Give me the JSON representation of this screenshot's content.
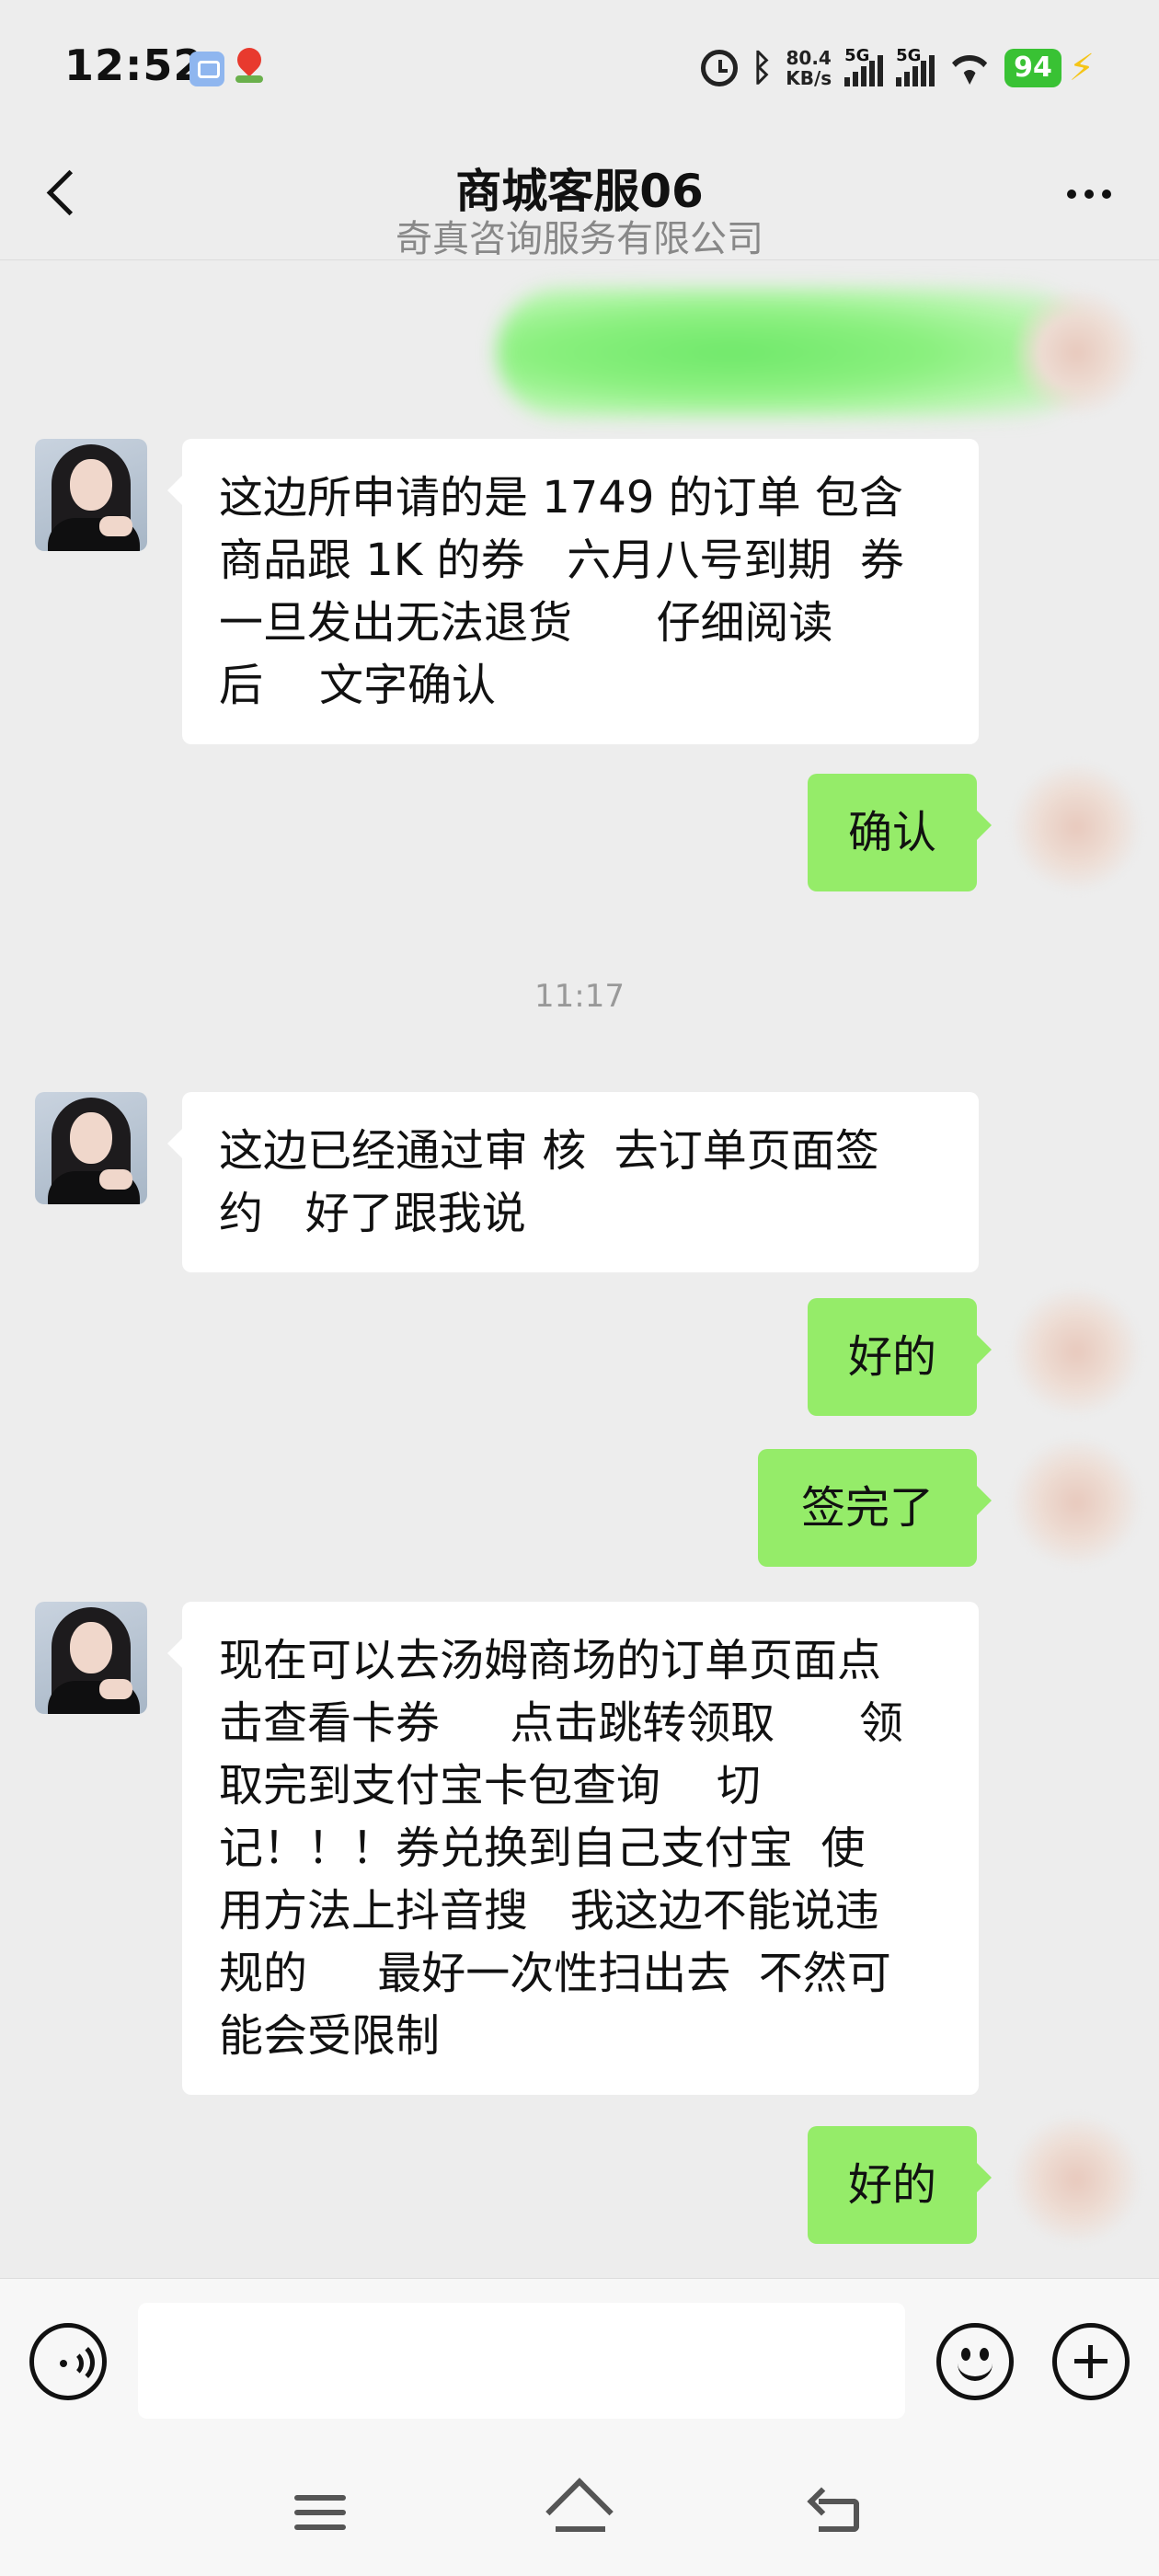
{
  "status_bar": {
    "time": "12:52",
    "net_speed_value": "80.4",
    "net_speed_unit": "KB/s",
    "sim1_label": "5G",
    "sim2_label": "5G",
    "battery": "94",
    "icons": [
      "app-notification-icon",
      "map-notification-icon",
      "alarm-icon",
      "bluetooth-icon",
      "signal-icon",
      "wifi-icon",
      "battery-icon",
      "charging-icon"
    ]
  },
  "header": {
    "title": "商城客服06",
    "subtitle": "奇真咨询服务有限公司"
  },
  "messages": [
    {
      "side": "left",
      "lines": [
        "这边所申请的是 1749 的订单 包含",
        "商品跟 1K 的券   六月八号到期  券",
        "一旦发出无法退货      仔细阅读",
        "后    文字确认"
      ]
    },
    {
      "side": "right",
      "text": "确认"
    },
    {
      "side": "left",
      "lines": [
        "这边已经通过审 核  去订单页面签",
        "约   好了跟我说"
      ]
    },
    {
      "side": "right",
      "text": "好的"
    },
    {
      "side": "right",
      "text": "签完了"
    },
    {
      "side": "left",
      "lines": [
        "现在可以去汤姆商场的订单页面点",
        "击查看卡券     点击跳转领取      领",
        "取完到支付宝卡包查询    切",
        "记！！！券兑换到自己支付宝  使",
        "用方法上抖音搜   我这边不能说违",
        "规的     最好一次性扫出去  不然可",
        "能会受限制"
      ]
    },
    {
      "side": "right",
      "text": "好的"
    }
  ],
  "timestamp": "11:17",
  "input_bar": {
    "placeholder": "",
    "icons": [
      "voice-icon",
      "emoji-icon",
      "plus-icon"
    ]
  },
  "nav_bar": {
    "icons": [
      "menu-icon",
      "home-icon",
      "back-icon"
    ]
  },
  "colors": {
    "background": "#ededed",
    "bubble_sent": "#95ec69",
    "bubble_received": "#ffffff",
    "battery": "#39c234"
  }
}
